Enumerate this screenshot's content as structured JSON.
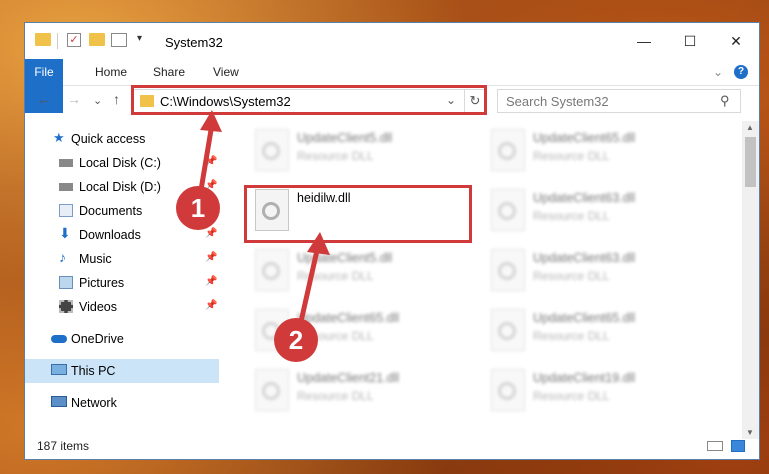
{
  "window": {
    "title": "System32",
    "minimize_glyph": "—",
    "maximize_glyph": "☐",
    "close_glyph": "✕"
  },
  "ribbon": {
    "file": "File",
    "home": "Home",
    "share": "Share",
    "view": "View",
    "help_glyph": "?",
    "expand_glyph": "⌄"
  },
  "navigation": {
    "back_glyph": "←",
    "forward_glyph": "→",
    "recent_glyph": "⌄",
    "up_glyph": "↑",
    "address": "C:\\Windows\\System32",
    "address_dropdown_glyph": "⌄",
    "refresh_glyph": "↻",
    "search_placeholder": "Search System32",
    "search_glyph": "⚲"
  },
  "sidebar": {
    "items": [
      {
        "label": "Quick access",
        "pinned": false
      },
      {
        "label": "Local Disk (C:)",
        "pinned": true
      },
      {
        "label": "Local Disk (D:)",
        "pinned": true
      },
      {
        "label": "Documents",
        "pinned": true
      },
      {
        "label": "Downloads",
        "pinned": true
      },
      {
        "label": "Music",
        "pinned": true
      },
      {
        "label": "Pictures",
        "pinned": true
      },
      {
        "label": "Videos",
        "pinned": true
      },
      {
        "label": "OneDrive",
        "pinned": false
      },
      {
        "label": "This PC",
        "pinned": false
      },
      {
        "label": "Network",
        "pinned": false
      }
    ],
    "pin_glyph": "📌"
  },
  "files": {
    "highlighted": {
      "name": "heidilw.dll"
    },
    "left_column": [
      {
        "name": "UpdateClient5.dll",
        "desc": "Resource DLL"
      },
      {
        "name": "UpdateClient5.dll",
        "desc": "Resource DLL"
      },
      {
        "name": "UpdateClient65.dll",
        "desc": "Resource DLL"
      },
      {
        "name": "UpdateClient21.dll",
        "desc": "Resource DLL"
      }
    ],
    "right_column": [
      {
        "name": "UpdateClient65.dll",
        "desc": "Resource DLL"
      },
      {
        "name": "UpdateClient63.dll",
        "desc": "Resource DLL"
      },
      {
        "name": "UpdateClient63.dll",
        "desc": "Resource DLL"
      },
      {
        "name": "UpdateClient65.dll",
        "desc": "Resource DLL"
      },
      {
        "name": "UpdateClient19.dll",
        "desc": "Resource DLL"
      }
    ]
  },
  "status": {
    "count": "187 items"
  },
  "callouts": {
    "one": "1",
    "two": "2"
  },
  "colors": {
    "accent": "#1e6fc8",
    "highlight": "#d03a3a",
    "selection": "#cce4f7"
  }
}
